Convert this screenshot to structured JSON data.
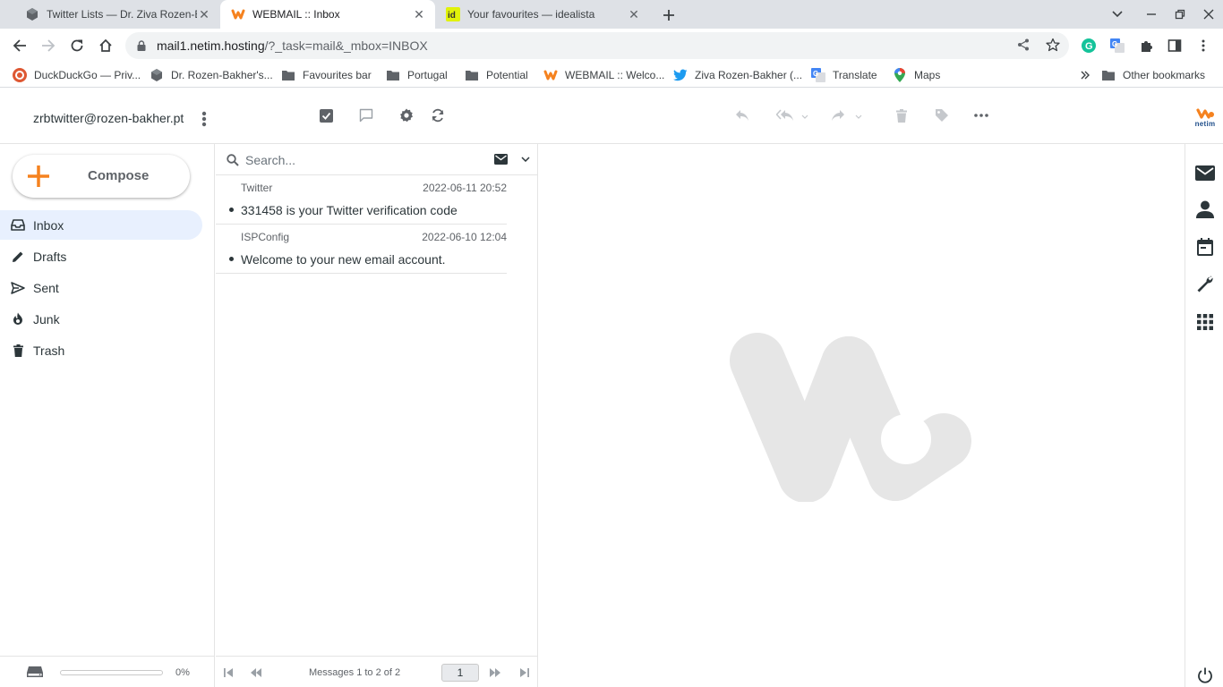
{
  "browser": {
    "tabs": [
      {
        "title": "Twitter Lists — Dr. Ziva Rozen-Ba",
        "icon": "cube-favicon-icon"
      },
      {
        "title": "WEBMAIL :: Inbox",
        "icon": "webmail-favicon-icon"
      },
      {
        "title": "Your favourites — idealista",
        "icon": "idealista-favicon-icon"
      }
    ],
    "address": {
      "host": "mail1.netim.hosting",
      "path": "/?_task=mail&_mbox=INBOX"
    },
    "bookmarks": [
      {
        "label": "DuckDuckGo — Priv...",
        "icon": "duckduckgo-icon"
      },
      {
        "label": "Dr. Rozen-Bakher's...",
        "icon": "cube-icon"
      },
      {
        "label": "Favourites bar",
        "icon": "folder-icon"
      },
      {
        "label": "Portugal",
        "icon": "folder-icon"
      },
      {
        "label": "Potential",
        "icon": "folder-icon"
      },
      {
        "label": "WEBMAIL :: Welco...",
        "icon": "webmail-icon"
      },
      {
        "label": "Ziva Rozen-Bakher (...",
        "icon": "twitter-icon"
      },
      {
        "label": "Translate",
        "icon": "translate-icon"
      },
      {
        "label": "Maps",
        "icon": "maps-icon"
      }
    ],
    "other_bookmarks": "Other bookmarks"
  },
  "webmail": {
    "account": "zrbtwitter@rozen-bakher.pt",
    "compose_label": "Compose",
    "folders": [
      {
        "label": "Inbox",
        "icon": "inbox-icon",
        "selected": true
      },
      {
        "label": "Drafts",
        "icon": "pencil-icon",
        "selected": false
      },
      {
        "label": "Sent",
        "icon": "send-icon",
        "selected": false
      },
      {
        "label": "Junk",
        "icon": "fire-icon",
        "selected": false
      },
      {
        "label": "Trash",
        "icon": "trash-icon",
        "selected": false
      }
    ],
    "quota": {
      "percent_label": "0%",
      "fraction": 0.0
    },
    "search_placeholder": "Search...",
    "messages": [
      {
        "from": "Twitter",
        "date": "2022-06-11 20:52",
        "subject": "331458 is your Twitter verification code"
      },
      {
        "from": "ISPConfig",
        "date": "2022-06-10 12:04",
        "subject": "Welcome to your new email account."
      }
    ],
    "pager": {
      "count_text": "Messages 1 to 2 of 2",
      "page": "1"
    },
    "logo_text": "netim",
    "colors": {
      "accent": "#f5821f",
      "selected_bg": "#e8f0fe",
      "text": "#2c363a"
    }
  }
}
